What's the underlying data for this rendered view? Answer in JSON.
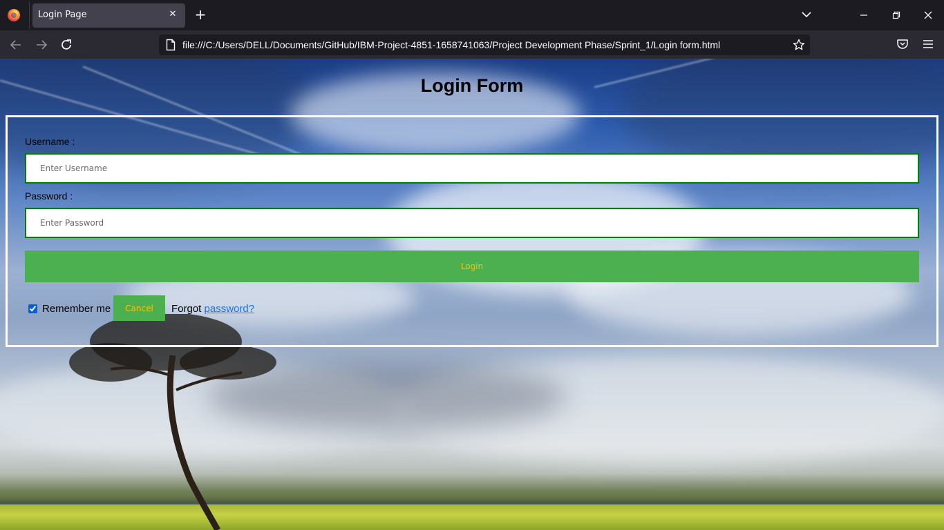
{
  "browser": {
    "tab_title": "Login Page",
    "tab_close": "✕",
    "new_tab": "+",
    "url": "file:///C:/Users/DELL/Documents/GitHub/IBM-Project-4851-1658741063/Project Development Phase/Sprint_1/Login form.html",
    "icons": [
      "firefox-logo",
      "chevron-down-icon",
      "minimize-icon",
      "maximize-icon",
      "close-icon",
      "back-icon",
      "forward-icon",
      "reload-icon",
      "page-icon",
      "star-icon",
      "pocket-icon",
      "menu-icon"
    ]
  },
  "page": {
    "title": "Login Form",
    "username_label": "Username :",
    "username_placeholder": "Enter Username",
    "username_value": "",
    "password_label": "Password :",
    "password_placeholder": "Enter Password",
    "password_value": "",
    "login_label": "Login",
    "remember_label": "Remember me",
    "remember_checked": true,
    "cancel_label": "Cancel",
    "forgot_prefix": "Forgot ",
    "forgot_link": "password?",
    "colors": {
      "button_bg": "#4caf50",
      "button_text": "#ffc107",
      "input_border": "#008000",
      "form_border": "#ffffff",
      "link": "#1a73e8"
    }
  }
}
